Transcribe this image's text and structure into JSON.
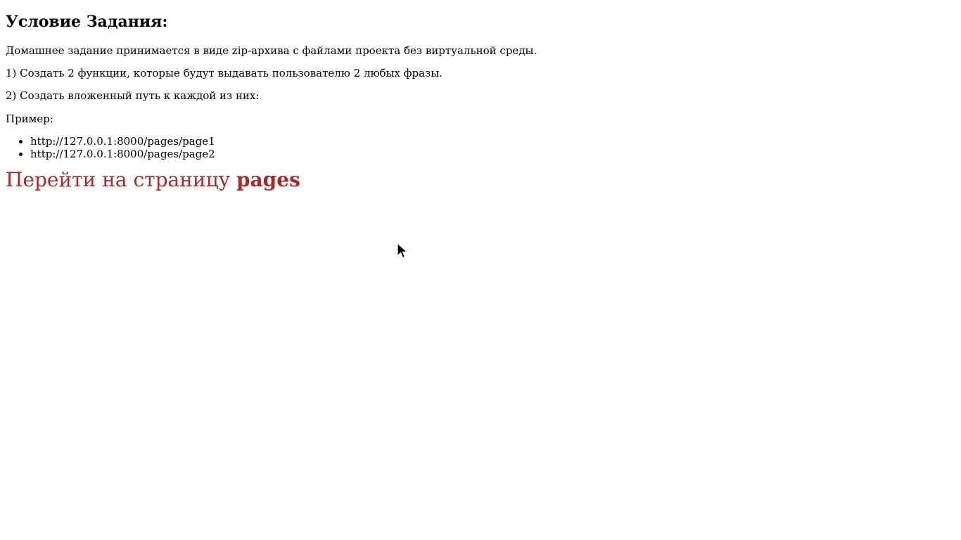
{
  "page": {
    "heading": "Условие Задания:",
    "paragraphs": [
      "Домашнее задание принимается в виде zip-архива с файлами проекта без виртуальной среды.",
      "1) Создать 2 функции, которые будут выдавать пользователю 2 любых фразы.",
      "2) Создать вложенный путь к каждой из них:",
      "Пример:"
    ],
    "examples": [
      "http://127.0.0.1:8000/pages/page1",
      "http://127.0.0.1:8000/pages/page2"
    ],
    "link": {
      "prefix": "Перейти на страницу ",
      "bold": "pages"
    }
  },
  "colors": {
    "link": "#a52a2a",
    "text": "#000000",
    "background": "#ffffff"
  },
  "icons": {
    "cursor": "mouse-pointer-icon"
  }
}
